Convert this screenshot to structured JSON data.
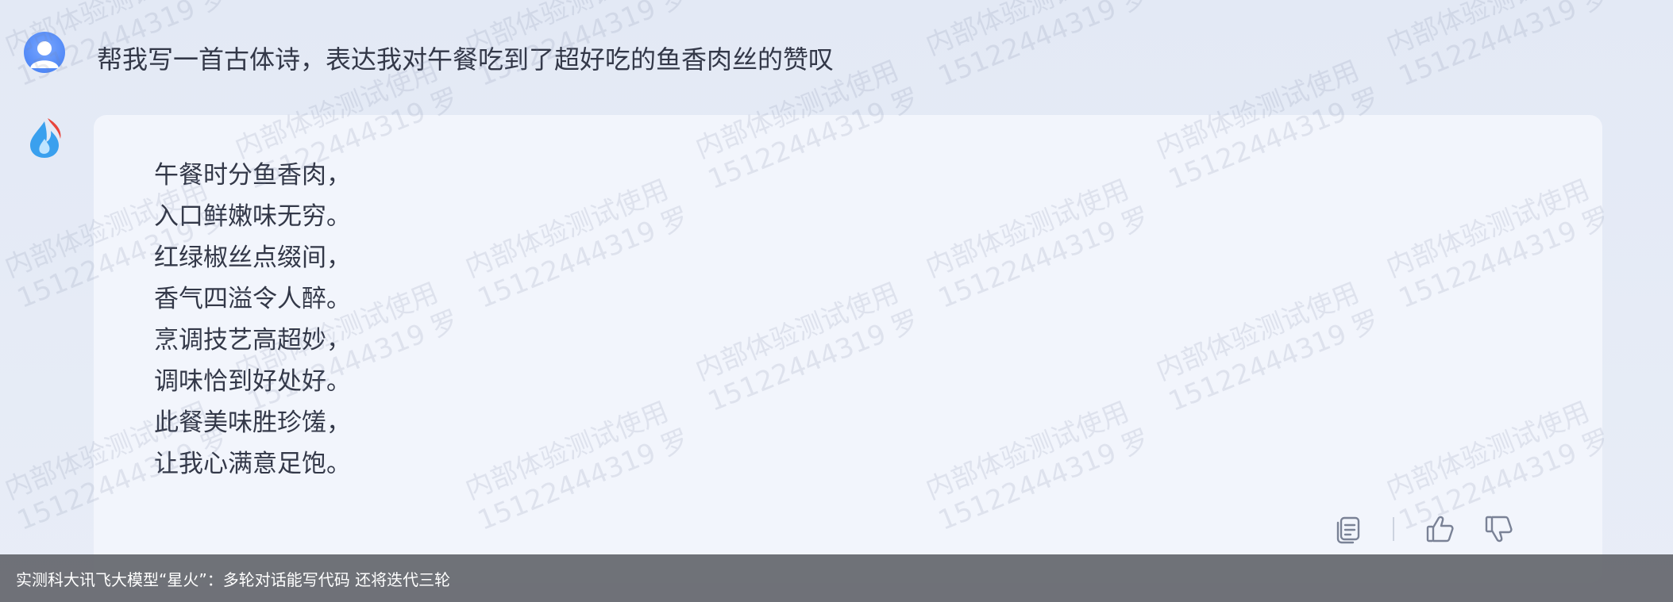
{
  "user_message": {
    "text": "帮我写一首古体诗，表达我对午餐吃到了超好吃的鱼香肉丝的赞叹"
  },
  "assistant_message": {
    "lines": [
      "午餐时分鱼香肉，",
      "入口鲜嫩味无穷。",
      "红绿椒丝点缀间，",
      "香气四溢令人醉。",
      "烹调技艺高超妙，",
      "调味恰到好处好。",
      "此餐美味胜珍馐，",
      "让我心满意足饱。"
    ]
  },
  "actions": {
    "copy_icon": "copy-icon",
    "like_icon": "thumbs-up-icon",
    "dislike_icon": "thumbs-down-icon"
  },
  "watermark": {
    "line1": "内部体验测试使用",
    "line2": "15122444319 罗"
  },
  "caption": {
    "text": "实测科大讯飞大模型“星火”：多轮对话能写代码  还将迭代三轮"
  },
  "colors": {
    "background": "#e3e9f5",
    "card": "#f2f5fc",
    "user_avatar": "#4b84f5",
    "caption_bar": "#64666c"
  }
}
